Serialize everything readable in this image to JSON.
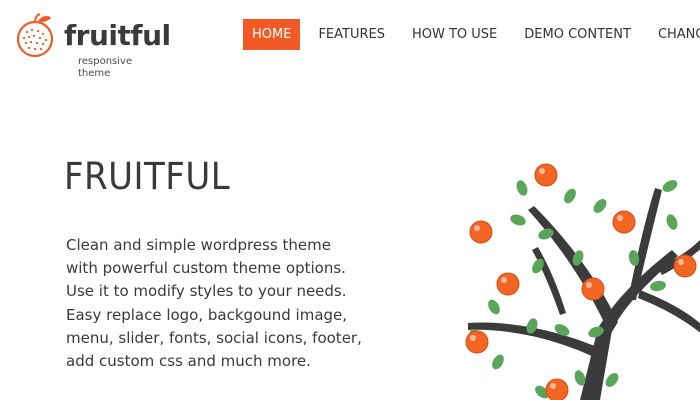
{
  "header": {
    "logo": {
      "title": "fruitful",
      "subtitle": "responsive theme"
    },
    "nav": {
      "items": [
        {
          "label": "HOME",
          "active": true
        },
        {
          "label": "FEATURES",
          "active": false
        },
        {
          "label": "HOW TO USE",
          "active": false
        },
        {
          "label": "DEMO CONTENT",
          "active": false
        },
        {
          "label": "CHANGELOG",
          "active": false
        }
      ]
    }
  },
  "hero": {
    "title": "FRUITFUL",
    "description_lines": [
      "Clean and simple wordpress theme",
      "with powerful custom theme options.",
      "Use it to modify styles to your needs.",
      "Easy replace logo, backgound image,",
      "menu, slider, fonts, social icons, footer,",
      "add custom css and much more."
    ]
  },
  "colors": {
    "accent": "#f15a24",
    "text": "#3a3a3a",
    "leaf": "#5aa55a",
    "branch": "#3b3b3b",
    "fruit": "#f26522"
  },
  "icons": {
    "logo_mark": "orange-fruit-icon",
    "illustration": "orange-tree-illustration"
  }
}
